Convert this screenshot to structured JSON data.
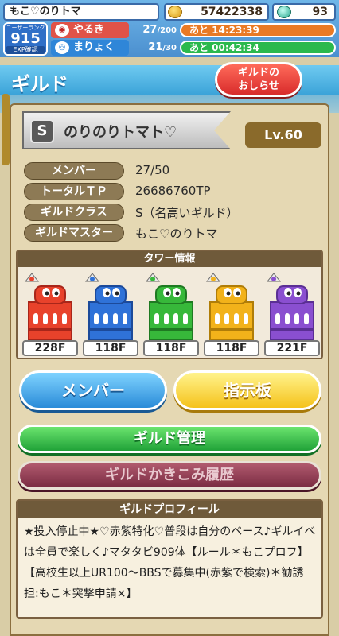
{
  "topbar": {
    "player_name": "もこ♡のりトマ",
    "coins": "57422338",
    "gems": "93",
    "rank_label": "ユーザーランク",
    "rank": "915",
    "exp_label": "EXP確認",
    "stamina": {
      "label": "やるき",
      "value": "27",
      "max": "/200",
      "timer": "あと 14:23:39",
      "fill": 0.97
    },
    "magic": {
      "label": "まりょく",
      "value": "21",
      "max": "/30",
      "timer": "あと 00:42:34",
      "fill": 0.97
    }
  },
  "header": {
    "title": "ギルド",
    "notice_button": "ギルドの\nおしらせ"
  },
  "guild": {
    "rank_badge": "S",
    "name": "のりのりトマト♡",
    "level": "Lv.60",
    "info": [
      {
        "label": "メンバー",
        "value": "27/50"
      },
      {
        "label": "トータルＴＰ",
        "value": "26686760TP"
      },
      {
        "label": "ギルドクラス",
        "value": "S（名高いギルド）"
      },
      {
        "label": "ギルドマスター",
        "value": "もこ♡のりトマ"
      }
    ]
  },
  "towers": {
    "title": "タワー情報",
    "items": [
      {
        "color": "red",
        "fill": "#e8422b",
        "dark": "#a8261a",
        "floor": "228F"
      },
      {
        "color": "blue",
        "fill": "#2f72d8",
        "dark": "#1c4a9a",
        "floor": "118F"
      },
      {
        "color": "green",
        "fill": "#37b83a",
        "dark": "#1f7a22",
        "floor": "118F"
      },
      {
        "color": "yellow",
        "fill": "#f2b21a",
        "dark": "#b07d08",
        "floor": "118F"
      },
      {
        "color": "purple",
        "fill": "#8a4fd0",
        "dark": "#5b2f94",
        "floor": "221F"
      }
    ]
  },
  "buttons": {
    "member": "メンバー",
    "board": "指示板",
    "manage": "ギルド管理",
    "history": "ギルドかきこみ履歴"
  },
  "profile": {
    "title": "ギルドプロフィール",
    "text": "★投入停止中★♡赤紫特化♡普段は自分のペース♪ギルイベは全員で楽しく♪マタタビ909体【ルール＊もこプロフ】【高校生以上UR100〜BBSで募集中(赤紫で検索)＊勧誘担:もこ＊突撃申請×】"
  }
}
